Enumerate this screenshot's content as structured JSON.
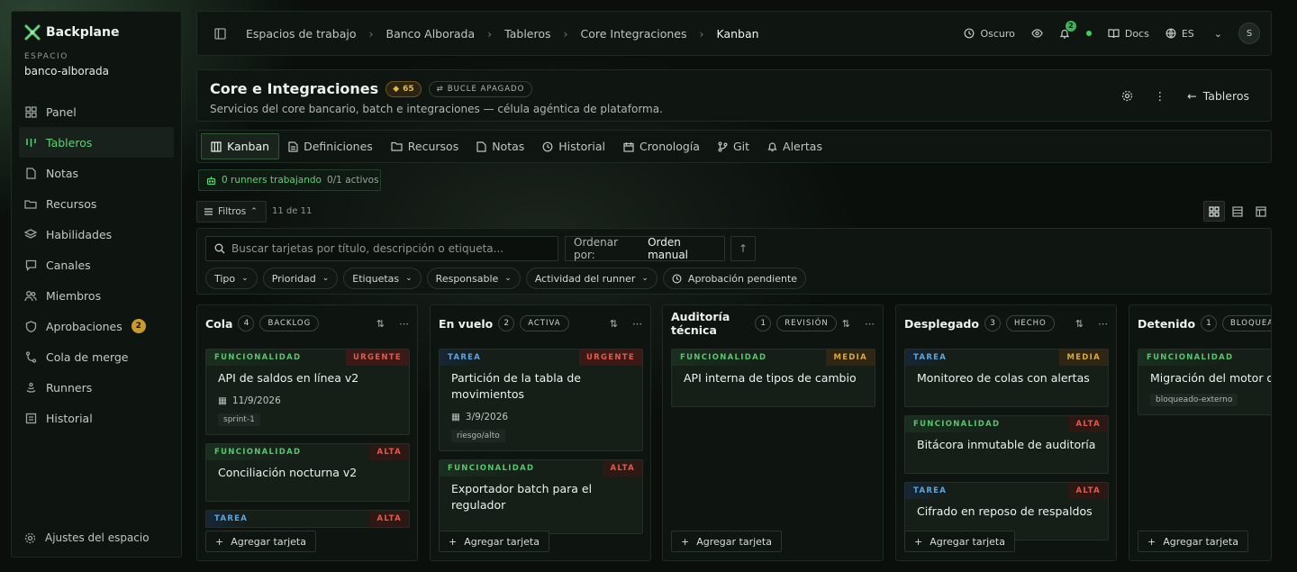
{
  "app": {
    "brand": "Backplane",
    "workspace_label": "ESPACIO",
    "workspace_name": "banco-alborada"
  },
  "sidebar": {
    "items": [
      {
        "label": "Panel",
        "icon": "grid-icon"
      },
      {
        "label": "Tableros",
        "icon": "kanban-icon",
        "active": true
      },
      {
        "label": "Notas",
        "icon": "note-icon"
      },
      {
        "label": "Recursos",
        "icon": "folder-icon"
      },
      {
        "label": "Habilidades",
        "icon": "layers-icon"
      },
      {
        "label": "Canales",
        "icon": "chat-icon"
      },
      {
        "label": "Miembros",
        "icon": "users-icon"
      },
      {
        "label": "Aprobaciones",
        "icon": "shield-icon",
        "badge": "2"
      },
      {
        "label": "Cola de merge",
        "icon": "merge-icon"
      },
      {
        "label": "Runners",
        "icon": "cpu-icon"
      },
      {
        "label": "Historial",
        "icon": "history-icon"
      }
    ],
    "settings_label": "Ajustes del espacio"
  },
  "topbar": {
    "breadcrumbs": [
      "Espacios de trabajo",
      "Banco Alborada",
      "Tableros",
      "Core Integraciones",
      "Kanban"
    ],
    "theme_label": "Oscuro",
    "notif_count": "2",
    "docs_label": "Docs",
    "lang_label": "ES",
    "avatar_initial": "S"
  },
  "header": {
    "title": "Core e Integraciones",
    "gem_count": "65",
    "loop_label": "BUCLE APAGADO",
    "description": "Servicios del core bancario, batch e integraciones — célula agéntica de plataforma.",
    "back_label": "Tableros"
  },
  "tabs": [
    "Kanban",
    "Definiciones",
    "Recursos",
    "Notas",
    "Historial",
    "Cronología",
    "Git",
    "Alertas"
  ],
  "runners": {
    "working": "0 runners trabajando",
    "active": "0/1 activos"
  },
  "filters": {
    "button_label": "Filtros",
    "count": "11 de 11",
    "search_placeholder": "Buscar tarjetas por título, descripción o etiqueta...",
    "order_label": "Ordenar por:",
    "order_value": "Orden manual",
    "chips": [
      "Tipo",
      "Prioridad",
      "Etiquetas",
      "Responsable",
      "Actividad del runner",
      "Aprobación pendiente"
    ]
  },
  "add_card_label": "Agregar tarjeta",
  "columns": [
    {
      "name": "Cola",
      "count": "4",
      "status": "BACKLOG",
      "cards": [
        {
          "type": "FUNCIONALIDAD",
          "kind": "feat",
          "priority": "URGENTE",
          "prio": "urg",
          "title": "API de saldos en línea v2",
          "date": "11/9/2026",
          "tag": "sprint-1"
        },
        {
          "type": "FUNCIONALIDAD",
          "kind": "feat",
          "priority": "ALTA",
          "prio": "alta",
          "title": "Conciliación nocturna v2"
        },
        {
          "type": "TAREA",
          "kind": "task",
          "priority": "ALTA",
          "prio": "alta",
          "title": ""
        }
      ]
    },
    {
      "name": "En vuelo",
      "count": "2",
      "status": "ACTIVA",
      "cards": [
        {
          "type": "TAREA",
          "kind": "task",
          "priority": "URGENTE",
          "prio": "urg",
          "title": "Partición de la tabla de movimientos",
          "date": "3/9/2026",
          "tag": "riesgo/alto"
        },
        {
          "type": "FUNCIONALIDAD",
          "kind": "feat",
          "priority": "ALTA",
          "prio": "alta",
          "title": "Exportador batch para el regulador"
        }
      ]
    },
    {
      "name": "Auditoría técnica",
      "count": "1",
      "status": "REVISIÓN",
      "cards": [
        {
          "type": "FUNCIONALIDAD",
          "kind": "feat",
          "priority": "MEDIA",
          "prio": "media",
          "title": "API interna de tipos de cambio"
        }
      ]
    },
    {
      "name": "Desplegado",
      "count": "3",
      "status": "HECHO",
      "cards": [
        {
          "type": "TAREA",
          "kind": "task",
          "priority": "MEDIA",
          "prio": "media",
          "title": "Monitoreo de colas con alertas"
        },
        {
          "type": "FUNCIONALIDAD",
          "kind": "feat",
          "priority": "ALTA",
          "prio": "alta",
          "title": "Bitácora inmutable de auditoría"
        },
        {
          "type": "TAREA",
          "kind": "task",
          "priority": "ALTA",
          "prio": "alta",
          "title": "Cifrado en reposo de respaldos"
        }
      ]
    },
    {
      "name": "Detenido",
      "count": "1",
      "status": "BLOQUEADA",
      "cards": [
        {
          "type": "FUNCIONALIDAD",
          "kind": "feat",
          "priority": "",
          "prio": "",
          "title": "Migración del motor de",
          "tag": "bloqueado-externo"
        }
      ]
    }
  ],
  "colors": {
    "accent": "#5fd17a",
    "urgent": "#e35a4d",
    "medium": "#d9a93a",
    "task": "#5aa6e0",
    "badge": "#c99a2e"
  }
}
